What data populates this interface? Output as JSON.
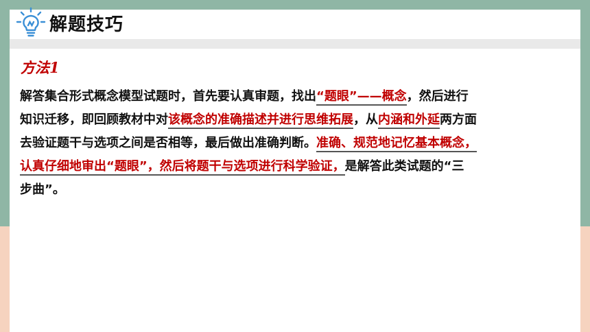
{
  "header": {
    "title": "解题技巧",
    "icon": "lightbulb-icon"
  },
  "method_label": "方法1",
  "paragraph": {
    "l1_a": "解答集合形式概念模型试题时，首先要认真审题，找出",
    "l1_hl": "“题眼”——概念",
    "l1_b": "，然后进行",
    "l2_a": "知识迁移，即回顾教材中对",
    "l2_hl1": "该概念的准确描述并进行思维拓展",
    "l2_b": "，从",
    "l2_hl2": "内涵和外延",
    "l2_c": "两方面",
    "l3_a": "去验证题干与选项之间是否相等，最后做出准确判断。",
    "l3_hl": "准确、规范地记忆基本概念，",
    "l4_hl": "认真仔细地审出“题眼”，然后将题干与选项进行科学验证，",
    "l4_b": "是解答此类试题的“三",
    "l5_a": "步曲”。"
  },
  "colors": {
    "accent_red": "#c00000",
    "frame_green": "#8fb6a5",
    "frame_peach": "#f6d3bf"
  }
}
